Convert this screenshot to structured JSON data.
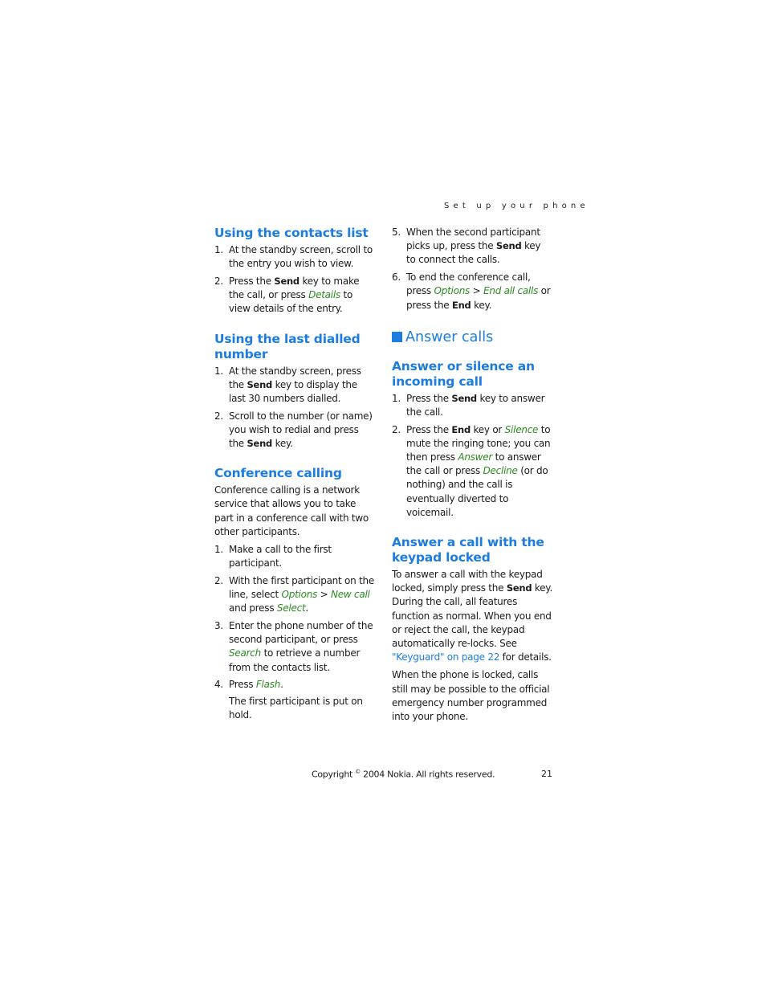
{
  "running_head": "Set up your phone",
  "left": {
    "contacts": {
      "heading": "Using the contacts list",
      "items": [
        {
          "num": "1.",
          "t1": "At the standby screen, scroll to the entry you wish to view."
        },
        {
          "num": "2.",
          "t1": "Press the ",
          "b1": "Send",
          "t2": " key to make the call, or press ",
          "g1": "Details",
          "t3": " to view details of the entry."
        }
      ]
    },
    "last_dialled": {
      "heading": "Using the last dialled number",
      "items": [
        {
          "num": "1.",
          "t1": "At the standby screen, press the ",
          "b1": "Send",
          "t2": " key to display the last 30 numbers dialled."
        },
        {
          "num": "2.",
          "t1": "Scroll to the number (or name) you wish to redial and press the ",
          "b1": "Send",
          "t2": " key."
        }
      ]
    },
    "conference": {
      "heading": "Conference calling",
      "intro": "Conference calling is a network service that allows you to take part in a conference call with two other participants.",
      "items": [
        {
          "num": "1.",
          "t1": "Make a call to the first participant."
        },
        {
          "num": "2.",
          "t1": "With the first participant on the line, select ",
          "g1": "Options",
          "t2": " > ",
          "g2": "New call",
          "t3": " and press ",
          "g3": "Select",
          "t4": "."
        },
        {
          "num": "3.",
          "t1": "Enter the phone number of the second participant, or press ",
          "g1": "Search",
          "t2": " to retrieve a number from the contacts list."
        },
        {
          "num": "4.",
          "t1": "Press ",
          "g1": "Flash",
          "t2": "."
        }
      ],
      "item4_note": "The first participant is put on hold."
    }
  },
  "right": {
    "conference_cont": {
      "items": [
        {
          "num": "5.",
          "t1": "When the second participant picks up, press the ",
          "b1": "Send",
          "t2": " key to connect the calls."
        },
        {
          "num": "6.",
          "t1": "To end the conference call, press ",
          "g1": "Options",
          "t2": " > ",
          "g2": "End all calls",
          "t3": " or press the ",
          "b1": "End",
          "t4": " key."
        }
      ]
    },
    "answer_calls": {
      "heading": "Answer calls"
    },
    "answer_silence": {
      "heading": "Answer or silence an incoming call",
      "items": [
        {
          "num": "1.",
          "t1": "Press the ",
          "b1": "Send",
          "t2": " key to answer the call."
        },
        {
          "num": "2.",
          "t1": "Press the ",
          "b1": "End",
          "t2": " key or ",
          "g1": "Silence",
          "t3": " to mute the ringing tone; you can then press ",
          "g2": "Answer",
          "t4": " to answer the call or press ",
          "g3": "Decline",
          "t5": " (or do nothing) and the call is eventually diverted to voicemail."
        }
      ]
    },
    "keypad_locked": {
      "heading": "Answer a call with the keypad locked",
      "p1": {
        "t1": "To answer a call with the keypad locked, simply press the ",
        "b1": "Send",
        "t2": " key. During the call, all features function as normal. When you end or reject the call, the keypad automatically re-locks. See ",
        "link": "\"Keyguard\" on page 22",
        "t3": " for details."
      },
      "p2": "When the phone is locked, calls still may be possible to the official emergency number programmed into your phone."
    }
  },
  "footer": {
    "copyright_pre": "Copyright ",
    "copyright_symbol": "©",
    "copyright_post": " 2004 Nokia. All rights reserved.",
    "page_number": "21"
  },
  "colors": {
    "heading_blue": "#1c7ce0",
    "softkey_green": "#2c8a22"
  }
}
